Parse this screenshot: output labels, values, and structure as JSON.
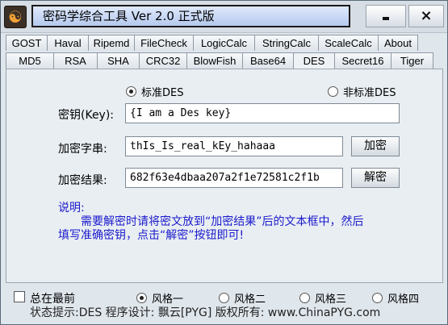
{
  "window": {
    "title": "密码学综合工具 Ver 2.0 正式版",
    "minimize_glyph": "_",
    "close_glyph": "×"
  },
  "tabs": {
    "row1": [
      {
        "label": "GOST",
        "w": 52
      },
      {
        "label": "Haval",
        "w": 52
      },
      {
        "label": "Ripemd",
        "w": 58
      },
      {
        "label": "FileCheck",
        "w": 74
      },
      {
        "label": "LogicCalc",
        "w": 77
      },
      {
        "label": "StringCalc",
        "w": 80
      },
      {
        "label": "ScaleCalc",
        "w": 75
      },
      {
        "label": "About",
        "w": 50
      }
    ],
    "row2": [
      {
        "label": "MD5",
        "w": 60
      },
      {
        "label": "RSA",
        "w": 55
      },
      {
        "label": "SHA",
        "w": 53
      },
      {
        "label": "CRC32",
        "w": 60
      },
      {
        "label": "BlowFish",
        "w": 70
      },
      {
        "label": "Base64",
        "w": 64
      },
      {
        "label": "DES",
        "w": 52,
        "active": true
      },
      {
        "label": "Secret16",
        "w": 71
      },
      {
        "label": "Tiger",
        "w": 53
      }
    ]
  },
  "des": {
    "mode_standard": "标准DES",
    "mode_nonstandard": "非标准DES",
    "key_label": "密钥(Key):",
    "key_value": "{I am a Des key}",
    "plain_label": "加密字串:",
    "plain_value": "thIs_Is_real_kEy_hahaaa",
    "encrypt_button": "加密",
    "result_label": "加密结果:",
    "result_value": "682f63e4dbaa207a2f1e72581c2f1b",
    "decrypt_button": "解密",
    "note_title": "说明:",
    "note_line1": "需要解密时请将密文放到“加密结果”后的文本框中，然后",
    "note_line2": "填写准确密钥，点击“解密”按钮即可!"
  },
  "footer": {
    "always_on_top": "总在最前",
    "styles": [
      "风格一",
      "风格二",
      "风格三",
      "风格四"
    ],
    "status": "状态提示:DES      程序设计: 飘云[PYG]   版权所有: www.ChinaPYG.com"
  },
  "colors": {
    "note": "#1a1acc",
    "title_bar_fill": "#b5c9ee"
  }
}
